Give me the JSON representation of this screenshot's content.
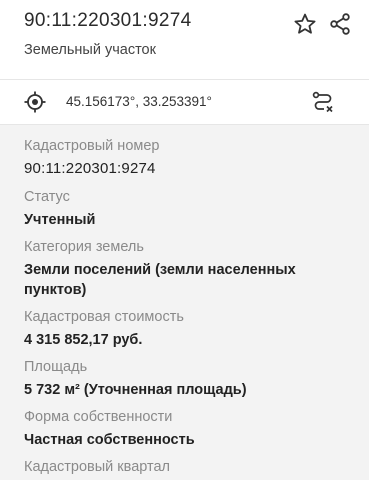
{
  "header": {
    "cadastral_number": "90:11:220301:9274",
    "object_type": "Земельный участок",
    "favorite_icon": "star-icon",
    "share_icon": "share-icon"
  },
  "coordinates": {
    "text": "45.156173°, 33.253391°",
    "locate_icon": "target-icon",
    "route_icon": "route-icon"
  },
  "details": {
    "cadastral_number_label": "Кадастровый номер",
    "cadastral_number_value": "90:11:220301:9274",
    "status_label": "Статус",
    "status_value": "Учтенный",
    "land_category_label": "Категория земель",
    "land_category_value": "Земли поселений (земли населенных пунктов)",
    "cadastral_value_label": "Кадастровая стоимость",
    "cadastral_value_value": "4 315 852,17 руб.",
    "area_label": "Площадь",
    "area_value": "5 732 м² (Уточненная площадь)",
    "ownership_label": "Форма собственности",
    "ownership_value": "Частная собственность",
    "cadastral_quarter_label": "Кадастровый квартал"
  },
  "colors": {
    "background": "#ffffff",
    "details_background": "#f3f3f3",
    "label": "#8a8a8a",
    "text": "#222222",
    "icon": "#333333"
  }
}
